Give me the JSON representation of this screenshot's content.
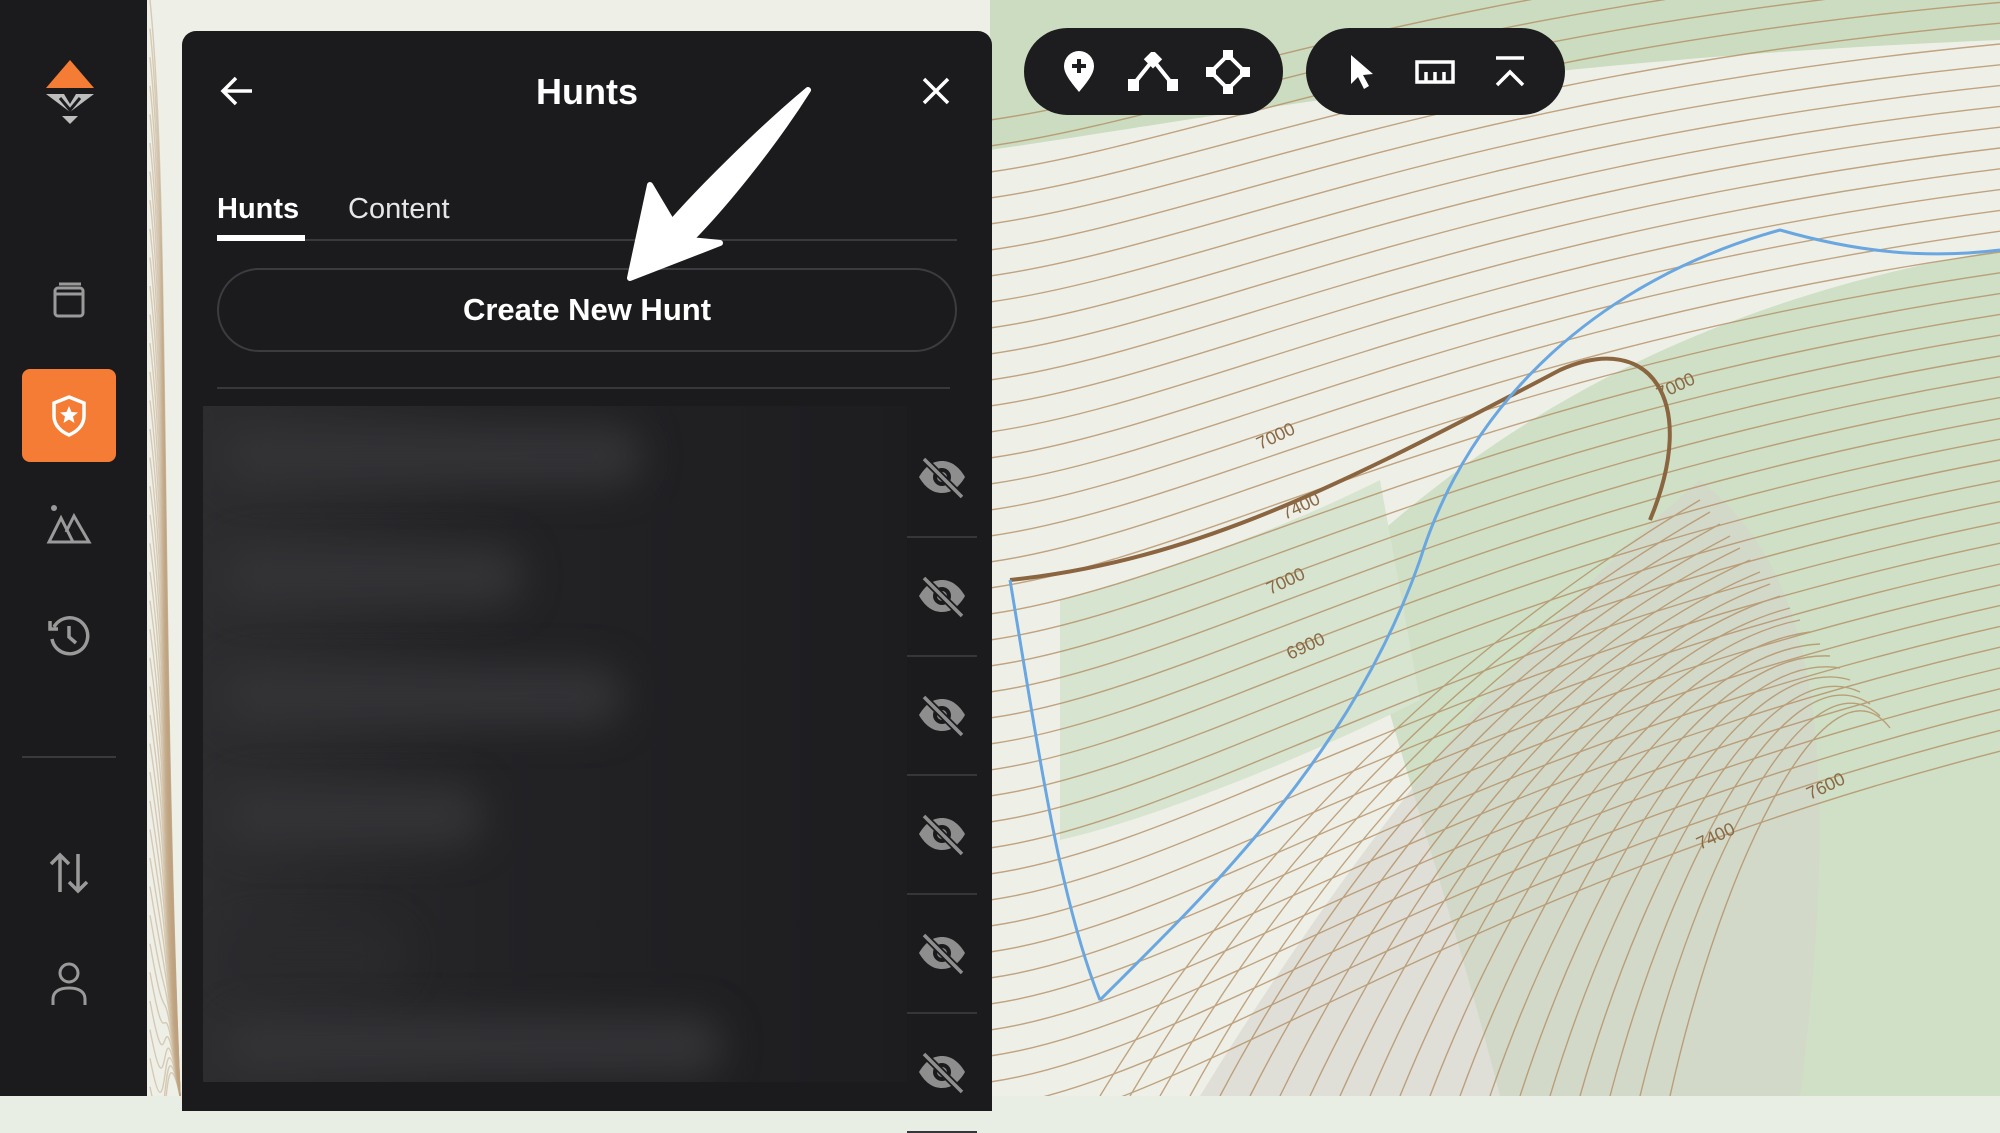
{
  "colors": {
    "accent": "#f47c34",
    "panel_bg": "#1b1b1e",
    "sidebar_bg": "#1b1b1d"
  },
  "sidebar": {
    "logo": "app-logo",
    "items": [
      {
        "icon": "book-icon",
        "active": false
      },
      {
        "icon": "shield-star-icon",
        "active": true
      },
      {
        "icon": "mountain-icon",
        "active": false
      },
      {
        "icon": "history-icon",
        "active": false
      },
      {
        "icon": "sort-arrows-icon",
        "active": false
      },
      {
        "icon": "user-icon",
        "active": false
      }
    ]
  },
  "panel": {
    "title": "Hunts",
    "back_icon": "arrow-left-icon",
    "close_icon": "close-icon",
    "tabs": [
      {
        "label": "Hunts",
        "active": true
      },
      {
        "label": "Content",
        "active": false
      }
    ],
    "create_button": "Create New Hunt",
    "rows": [
      {
        "visible": false
      },
      {
        "visible": false
      },
      {
        "visible": false
      },
      {
        "visible": false
      },
      {
        "visible": false
      },
      {
        "visible": false
      }
    ]
  },
  "toolbar_draw": [
    "add-marker-icon",
    "line-icon",
    "polygon-icon"
  ],
  "toolbar_tools": [
    "pointer-icon",
    "ruler-icon",
    "elevation-profile-icon"
  ],
  "map": {
    "contour_labels": [
      "7000",
      "7400",
      "7000",
      "6900",
      "7000",
      "7600",
      "7400"
    ]
  }
}
